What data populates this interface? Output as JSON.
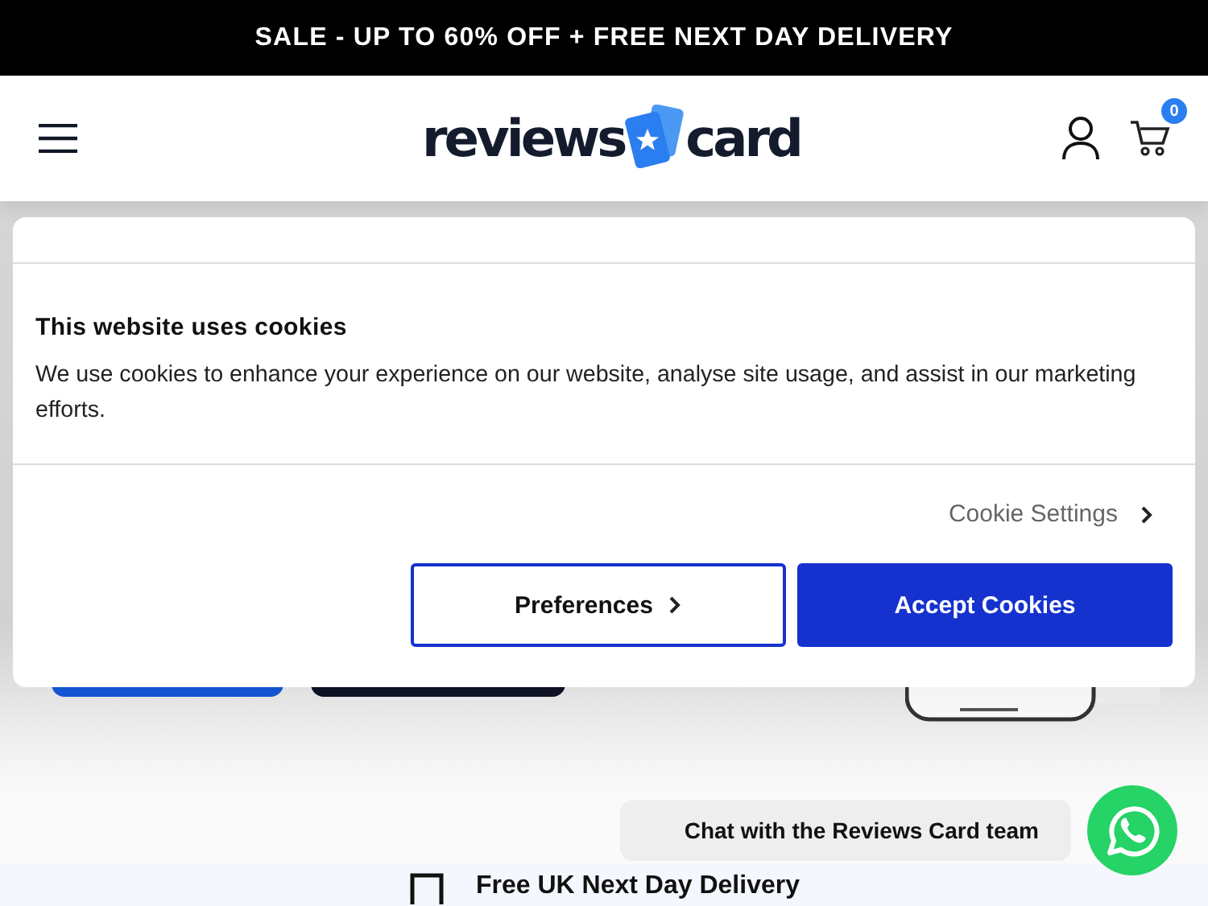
{
  "promo_bar": {
    "text": "SALE - UP TO 60% OFF + FREE NEXT DAY DELIVERY"
  },
  "header": {
    "logo_left": "reviews",
    "logo_right": "card",
    "cart_count": "0"
  },
  "cookie_dialog": {
    "title": "This website uses cookies",
    "body": "We use cookies to enhance your experience on our website, analyse site usage, and assist in our marketing efforts.",
    "settings_link": "Cookie Settings",
    "buttons": [
      {
        "label": "Preferences",
        "kind": "outline"
      },
      {
        "label": "Accept Cookies",
        "kind": "primary"
      }
    ]
  },
  "chat": {
    "label": "Chat with the Reviews Card team"
  },
  "delivery_strip": {
    "text": "Free UK Next Day Delivery"
  }
}
